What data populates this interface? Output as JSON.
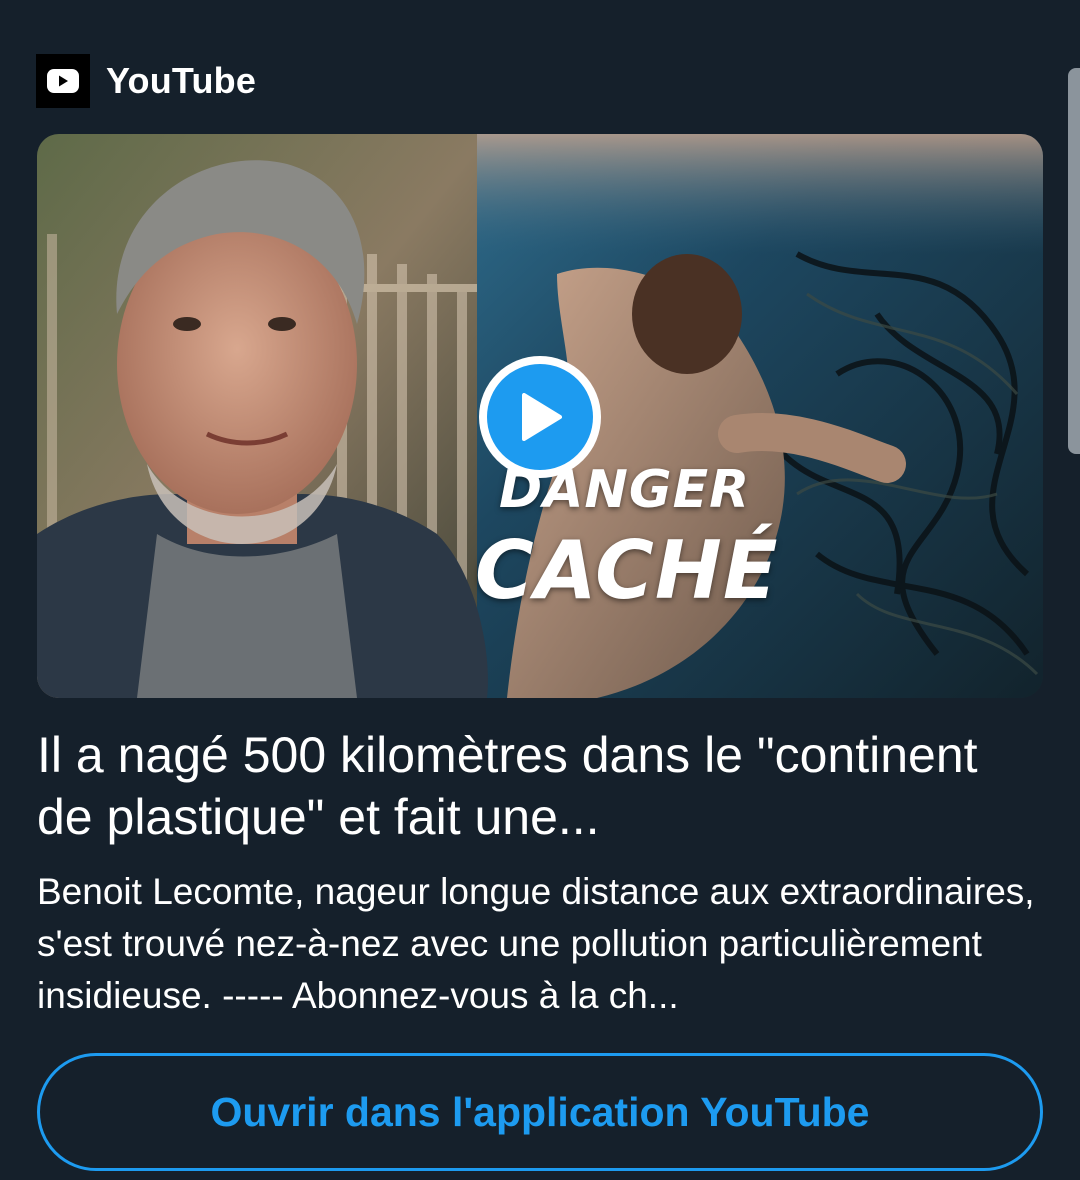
{
  "card": {
    "source": "YouTube",
    "source_icon": "youtube-icon",
    "thumbnail": {
      "overlay_line1": "DANGER",
      "overlay_line2": "CACHÉ",
      "play_icon": "play-icon"
    },
    "title": "Il a nagé 500 kilomètres dans le \"continent de plastique\" et fait une...",
    "description": "Benoit Lecomte, nageur longue distance aux extraordinaires, s'est trouvé nez-à-nez avec une pollution particulièrement insidieuse. ----- Abonnez-vous à la ch...",
    "open_button_label": "Ouvrir dans l'application YouTube"
  },
  "colors": {
    "background": "#15202b",
    "accent": "#1d9bf0",
    "text": "#ffffff"
  }
}
